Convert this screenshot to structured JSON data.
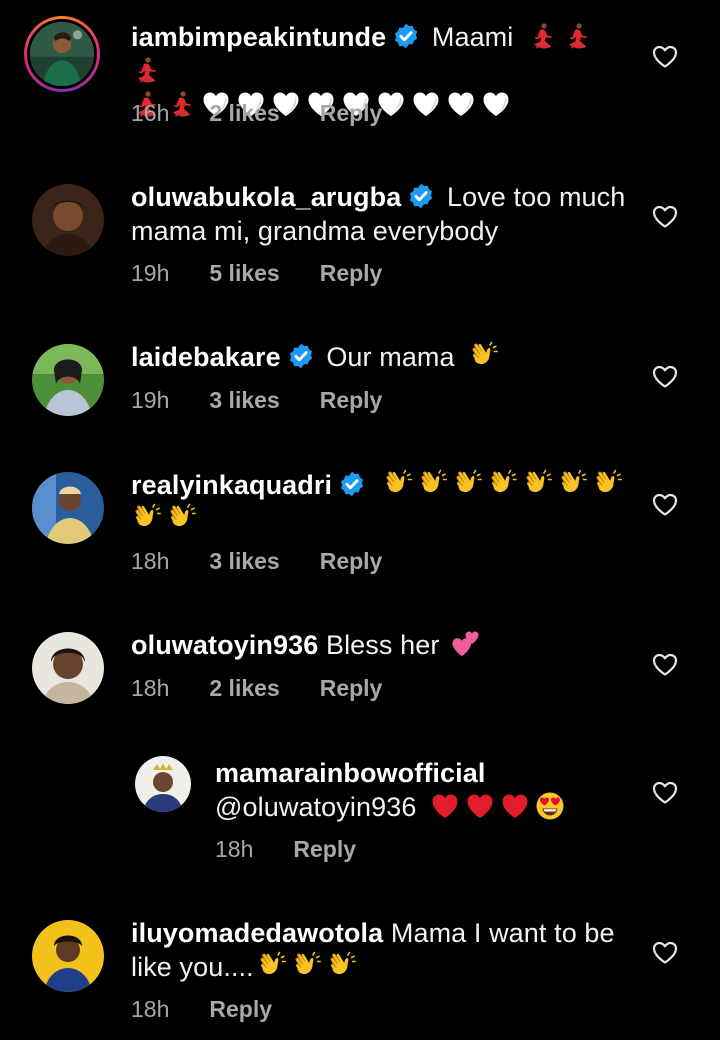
{
  "colors": {
    "background": "#000000",
    "text": "#f2f2f2",
    "meta": "#a8a8a8",
    "verified": "#1d9bf0"
  },
  "icons": {
    "verified": "verified-badge-icon",
    "like": "heart-outline-icon"
  },
  "comments": [
    {
      "username": "iambimpeakintunde",
      "verified": true,
      "text": "Maami",
      "emojis": [
        "dancer",
        "dancer",
        "dancer",
        "dancer",
        "dancer",
        "white-heart",
        "white-heart",
        "white-heart",
        "white-heart",
        "white-heart",
        "white-heart",
        "white-heart",
        "white-heart",
        "white-heart"
      ],
      "time": "16h",
      "likes": "2 likes",
      "reply": "Reply"
    },
    {
      "username": "oluwabukola_arugba",
      "verified": true,
      "text": "Love too much mama mi, grandma everybody",
      "time": "19h",
      "likes": "5 likes",
      "reply": "Reply"
    },
    {
      "username": "laidebakare",
      "verified": true,
      "text": "Our mama",
      "emojis": [
        "clap"
      ],
      "time": "19h",
      "likes": "3 likes",
      "reply": "Reply"
    },
    {
      "username": "realyinkaquadri",
      "verified": true,
      "text": "",
      "emojis": [
        "clap",
        "clap",
        "clap",
        "clap",
        "clap",
        "clap",
        "clap",
        "clap",
        "clap"
      ],
      "time": "18h",
      "likes": "3 likes",
      "reply": "Reply"
    },
    {
      "username": "oluwatoyin936",
      "verified": false,
      "text": "Bless her",
      "emojis": [
        "two-hearts"
      ],
      "time": "18h",
      "likes": "2 likes",
      "reply": "Reply"
    },
    {
      "username": "mamarainbowofficial",
      "verified": false,
      "text": "@oluwatoyin936",
      "emojis": [
        "red-heart",
        "red-heart",
        "red-heart",
        "heart-eyes"
      ],
      "time": "18h",
      "reply": "Reply"
    },
    {
      "username": "iluyomadedawotola",
      "verified": false,
      "text": "Mama I want to be like you....",
      "emojis": [
        "clap",
        "clap",
        "clap"
      ],
      "time": "18h",
      "reply": "Reply"
    }
  ]
}
